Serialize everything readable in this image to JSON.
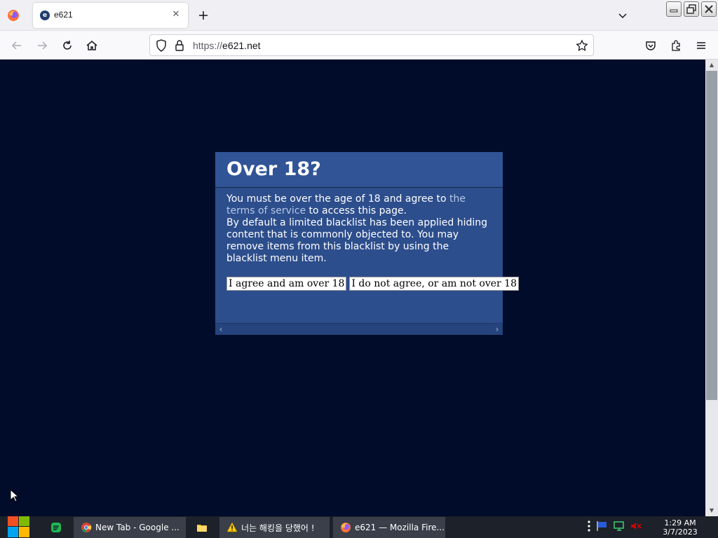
{
  "browser": {
    "tab": {
      "title": "e621",
      "favicon_letter": "e"
    },
    "url": {
      "scheme": "https://",
      "host": "e621.net"
    }
  },
  "dialog": {
    "title": "Over 18?",
    "text_before_link": "You must be over the age of 18 and agree to ",
    "link_text": "the terms of service",
    "text_after_link": " to access this page.",
    "text_blacklist": "By default a limited blacklist has been applied hiding content that is commonly objected to. You may remove items from this blacklist by using the blacklist menu item.",
    "agree_button": "I agree and am over 18",
    "disagree_button": "I do not agree, or am not over 18"
  },
  "taskbar": {
    "items": [
      {
        "label": "New Tab - Google ...",
        "icon": "chrome-icon"
      },
      {
        "label": "",
        "icon": "folder-icon"
      },
      {
        "label": "너는 해킹을 당했어 !",
        "icon": "warning-icon"
      },
      {
        "label": "e621 — Mozilla Fire...",
        "icon": "firefox-icon"
      }
    ],
    "clock": {
      "time": "1:29 AM",
      "date": "3/7/2023"
    }
  },
  "colors": {
    "page_background": "#000c2a",
    "dialog_background": "#2d4e8c",
    "link": "#b4c7e7"
  }
}
